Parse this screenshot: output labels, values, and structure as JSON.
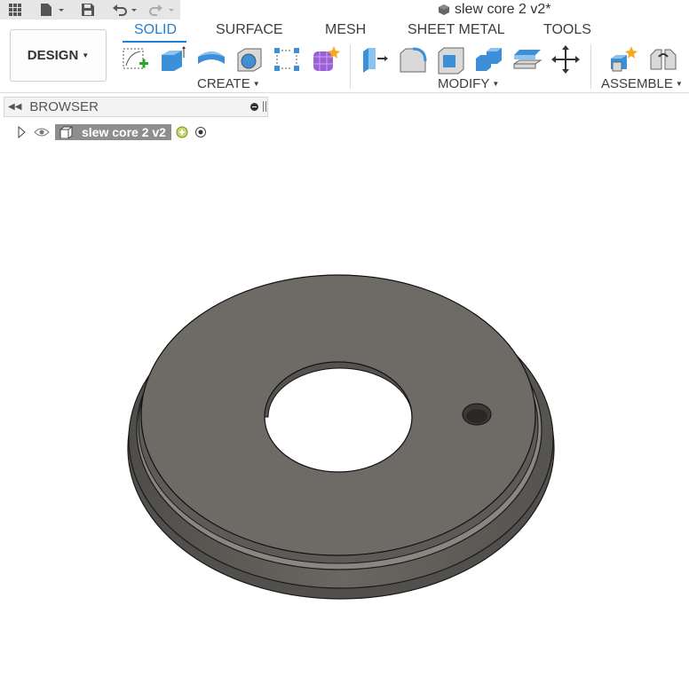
{
  "app": {
    "document_title": "slew core 2 v2*"
  },
  "quick_access": {
    "icons": [
      "grid-icon",
      "file-icon",
      "save-icon",
      "undo-icon",
      "redo-icon"
    ]
  },
  "ribbon": {
    "workspace_label": "DESIGN",
    "tabs": [
      {
        "label": "SOLID",
        "active": true
      },
      {
        "label": "SURFACE",
        "active": false
      },
      {
        "label": "MESH",
        "active": false
      },
      {
        "label": "SHEET METAL",
        "active": false
      },
      {
        "label": "TOOLS",
        "active": false
      }
    ],
    "groups": {
      "create": {
        "label": "CREATE",
        "tools": [
          "create-sketch-icon",
          "extrude-icon",
          "revolve-icon",
          "hole-icon",
          "pattern-icon",
          "create-form-icon"
        ]
      },
      "modify": {
        "label": "MODIFY",
        "tools": [
          "press-pull-icon",
          "fillet-icon",
          "shell-icon",
          "combine-icon",
          "offset-face-icon",
          "move-icon"
        ]
      },
      "assemble": {
        "label": "ASSEMBLE",
        "tools": [
          "new-component-icon",
          "joint-icon"
        ]
      }
    }
  },
  "browser": {
    "title": "BROWSER",
    "root_item": {
      "label": "slew core 2 v2"
    }
  },
  "colors": {
    "accent": "#1f7fd3",
    "model_face": "#6e6b66",
    "model_edge": "#111111"
  }
}
